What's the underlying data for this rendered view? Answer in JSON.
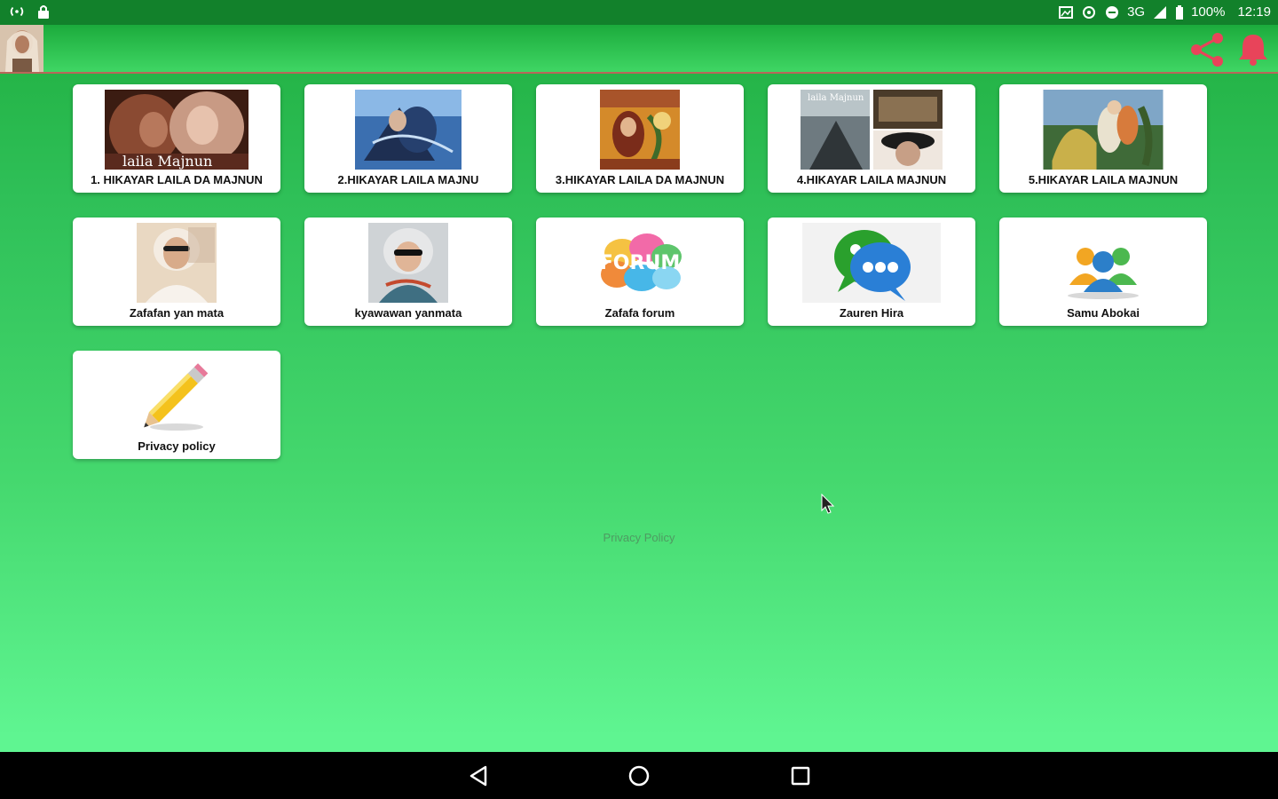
{
  "status_bar": {
    "network": "3G",
    "battery": "100%",
    "time": "12:19"
  },
  "app_bar": {
    "share_icon": "share-icon",
    "bell_icon": "bell-icon",
    "accent_color": "#e8445a"
  },
  "tiles": [
    {
      "label": "1. HIKAYAR LAILA DA MAJNUN",
      "thumb_caption": "laila Majnun"
    },
    {
      "label": "2.HIKAYAR LAILA MAJNU"
    },
    {
      "label": "3.HIKAYAR LAILA DA MAJNUN"
    },
    {
      "label": "4.HIKAYAR LAILA MAJNUN",
      "thumb_caption": "laila Majnun"
    },
    {
      "label": "5.HIKAYAR LAILA MAJNUN"
    },
    {
      "label": "Zafafan yan mata"
    },
    {
      "label": "kyawawan yanmata"
    },
    {
      "label": "Zafafa forum",
      "icon_text": "FORUM"
    },
    {
      "label": "Zauren Hira"
    },
    {
      "label": "Samu Abokai"
    },
    {
      "label": "Privacy policy"
    }
  ],
  "footer": {
    "privacy_link": "Privacy Policy"
  },
  "nav_bar": {
    "back_icon": "back-triangle-icon",
    "home_icon": "home-circle-icon",
    "recents_icon": "recents-square-icon"
  },
  "colors": {
    "status_bar": "#12812b",
    "background_top": "#1fae3f",
    "background_bottom": "#5ff591",
    "tile_bg": "#ffffff"
  }
}
